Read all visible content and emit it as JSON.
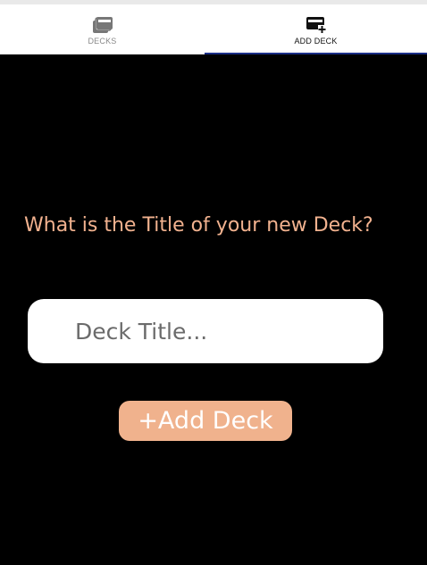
{
  "tabs": {
    "decks": {
      "label": "DECKS",
      "icon": "cards-stack-icon"
    },
    "add_deck": {
      "label": "ADD DECK",
      "icon": "add-card-icon",
      "active": true
    }
  },
  "form": {
    "heading": "What is the Title of your new Deck?",
    "title_placeholder": "Deck Title...",
    "title_value": "",
    "submit_label": "+Add Deck"
  },
  "colors": {
    "background": "#000000",
    "accent": "#f0b28d",
    "heading_text": "#f2b28f",
    "tab_indicator": "#1c2f88"
  }
}
